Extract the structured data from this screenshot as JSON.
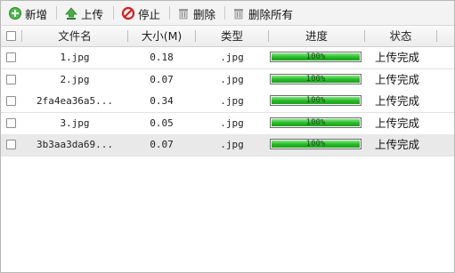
{
  "toolbar": {
    "add_label": "新增",
    "upload_label": "上传",
    "stop_label": "停止",
    "delete_label": "删除",
    "delete_all_label": "删除所有"
  },
  "columns": {
    "filename": "文件名",
    "size": "大小(M)",
    "type": "类型",
    "progress": "进度",
    "status": "状态"
  },
  "rows": [
    {
      "filename": "1.jpg",
      "size": "0.18",
      "type": ".jpg",
      "progress_text": "100%",
      "progress": 1.0,
      "status": "上传完成"
    },
    {
      "filename": "2.jpg",
      "size": "0.07",
      "type": ".jpg",
      "progress_text": "100%",
      "progress": 1.0,
      "status": "上传完成"
    },
    {
      "filename": "2fa4ea36a5...",
      "size": "0.34",
      "type": ".jpg",
      "progress_text": "100%",
      "progress": 1.0,
      "status": "上传完成"
    },
    {
      "filename": "3.jpg",
      "size": "0.05",
      "type": ".jpg",
      "progress_text": "100%",
      "progress": 1.0,
      "status": "上传完成"
    },
    {
      "filename": "3b3aa3da69...",
      "size": "0.07",
      "type": ".jpg",
      "progress_text": "100%",
      "progress": 1.0,
      "status": "上传完成"
    }
  ],
  "icons": {
    "add": "plus-circle-icon",
    "upload": "upload-arrow-icon",
    "stop": "stop-icon",
    "delete": "trash-icon",
    "delete_all": "trash-all-icon"
  },
  "colors": {
    "progress_fill": "#26b826",
    "add_icon": "#3aa33a",
    "stop_icon": "#d42020"
  }
}
